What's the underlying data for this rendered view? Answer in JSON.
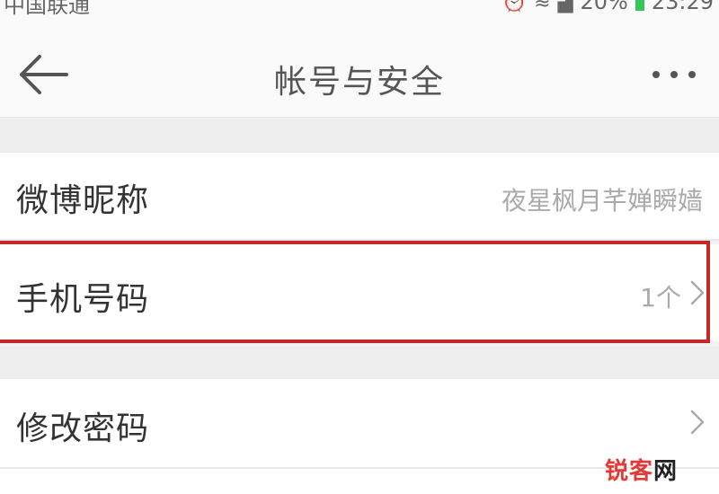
{
  "status_bar": {
    "carrier": "中国联通",
    "icons": [
      "alarm-icon",
      "wifi-icon",
      "signal-icon"
    ],
    "battery": "20%",
    "time": "23:29"
  },
  "nav": {
    "title": "帐号与安全",
    "back_icon": "back-arrow-icon",
    "more_icon": "more-icon"
  },
  "settings": {
    "rows": [
      {
        "label": "微博昵称",
        "value": "夜星枫月芊婵瞬嫱",
        "has_chevron": false
      },
      {
        "label": "手机号码",
        "value": "1个",
        "has_chevron": true,
        "highlighted": true
      },
      {
        "label": "修改密码",
        "value": "",
        "has_chevron": true
      }
    ]
  },
  "watermark": {
    "part1": "锐客",
    "part2": "网"
  },
  "colors": {
    "highlight": "#c62828",
    "watermark_red": "#e53935",
    "battery": "#34c759"
  }
}
